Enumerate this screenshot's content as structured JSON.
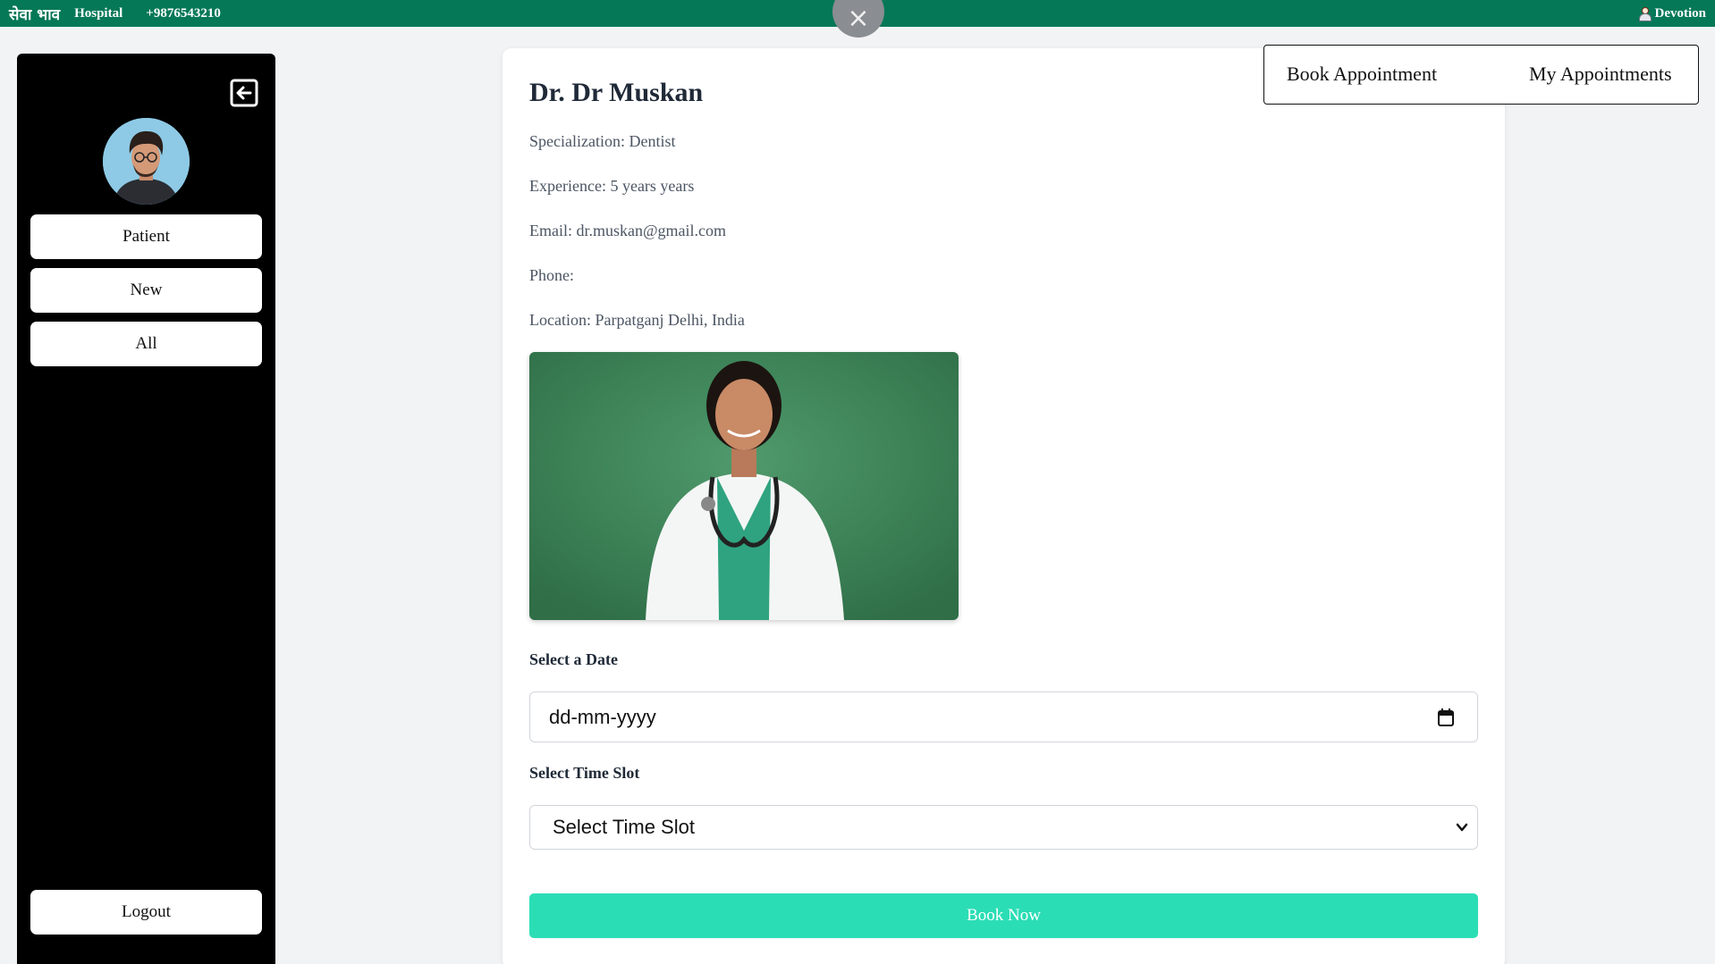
{
  "topbar": {
    "brand": "सेवा भाव",
    "hospital": "Hospital",
    "phone": "+9876543210",
    "user_name": "Devotion",
    "user_icon": "user-icon",
    "bg_color": "#047857"
  },
  "overlay": {
    "close_icon": "×"
  },
  "sidebar": {
    "collapse_icon": "arrow-left-square-icon",
    "items": [
      {
        "label": "Patient"
      },
      {
        "label": "New"
      },
      {
        "label": "All"
      }
    ],
    "logout_label": "Logout"
  },
  "doctor": {
    "name": "Dr. Dr Muskan",
    "specialization": "Specialization: Dentist",
    "experience": "Experience: 5 years years",
    "email": "Email: dr.muskan@gmail.com",
    "phone": "Phone:",
    "location": "Location: Parpatganj Delhi, India"
  },
  "form": {
    "date_label": "Select a Date",
    "date_placeholder": "dd-mm-yyyy",
    "time_label": "Select Time Slot",
    "time_selected": "Select Time Slot",
    "book_label": "Book Now",
    "book_color": "#2bddb5"
  },
  "tabs": {
    "book": "Book Appointment",
    "mine": "My Appointments"
  }
}
